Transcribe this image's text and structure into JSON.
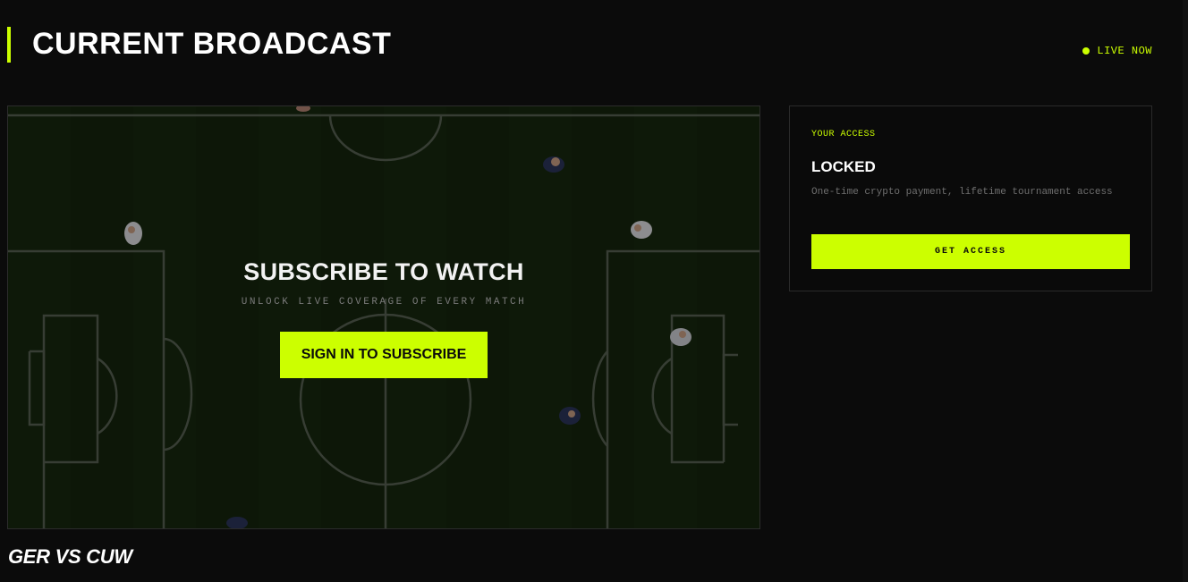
{
  "header": {
    "title": "CURRENT BROADCAST",
    "live_label": "LIVE NOW"
  },
  "video": {
    "overlay_title": "SUBSCRIBE TO WATCH",
    "overlay_subtitle": "UNLOCK LIVE COVERAGE OF EVERY MATCH",
    "sign_in_label": "SIGN IN TO SUBSCRIBE",
    "match_title": "GER VS CUW"
  },
  "access": {
    "label": "YOUR ACCESS",
    "status": "LOCKED",
    "description": "One-time crypto payment, lifetime tournament access",
    "button_label": "GET ACCESS"
  },
  "colors": {
    "accent": "#ccff00",
    "background": "#0b0b0b"
  }
}
